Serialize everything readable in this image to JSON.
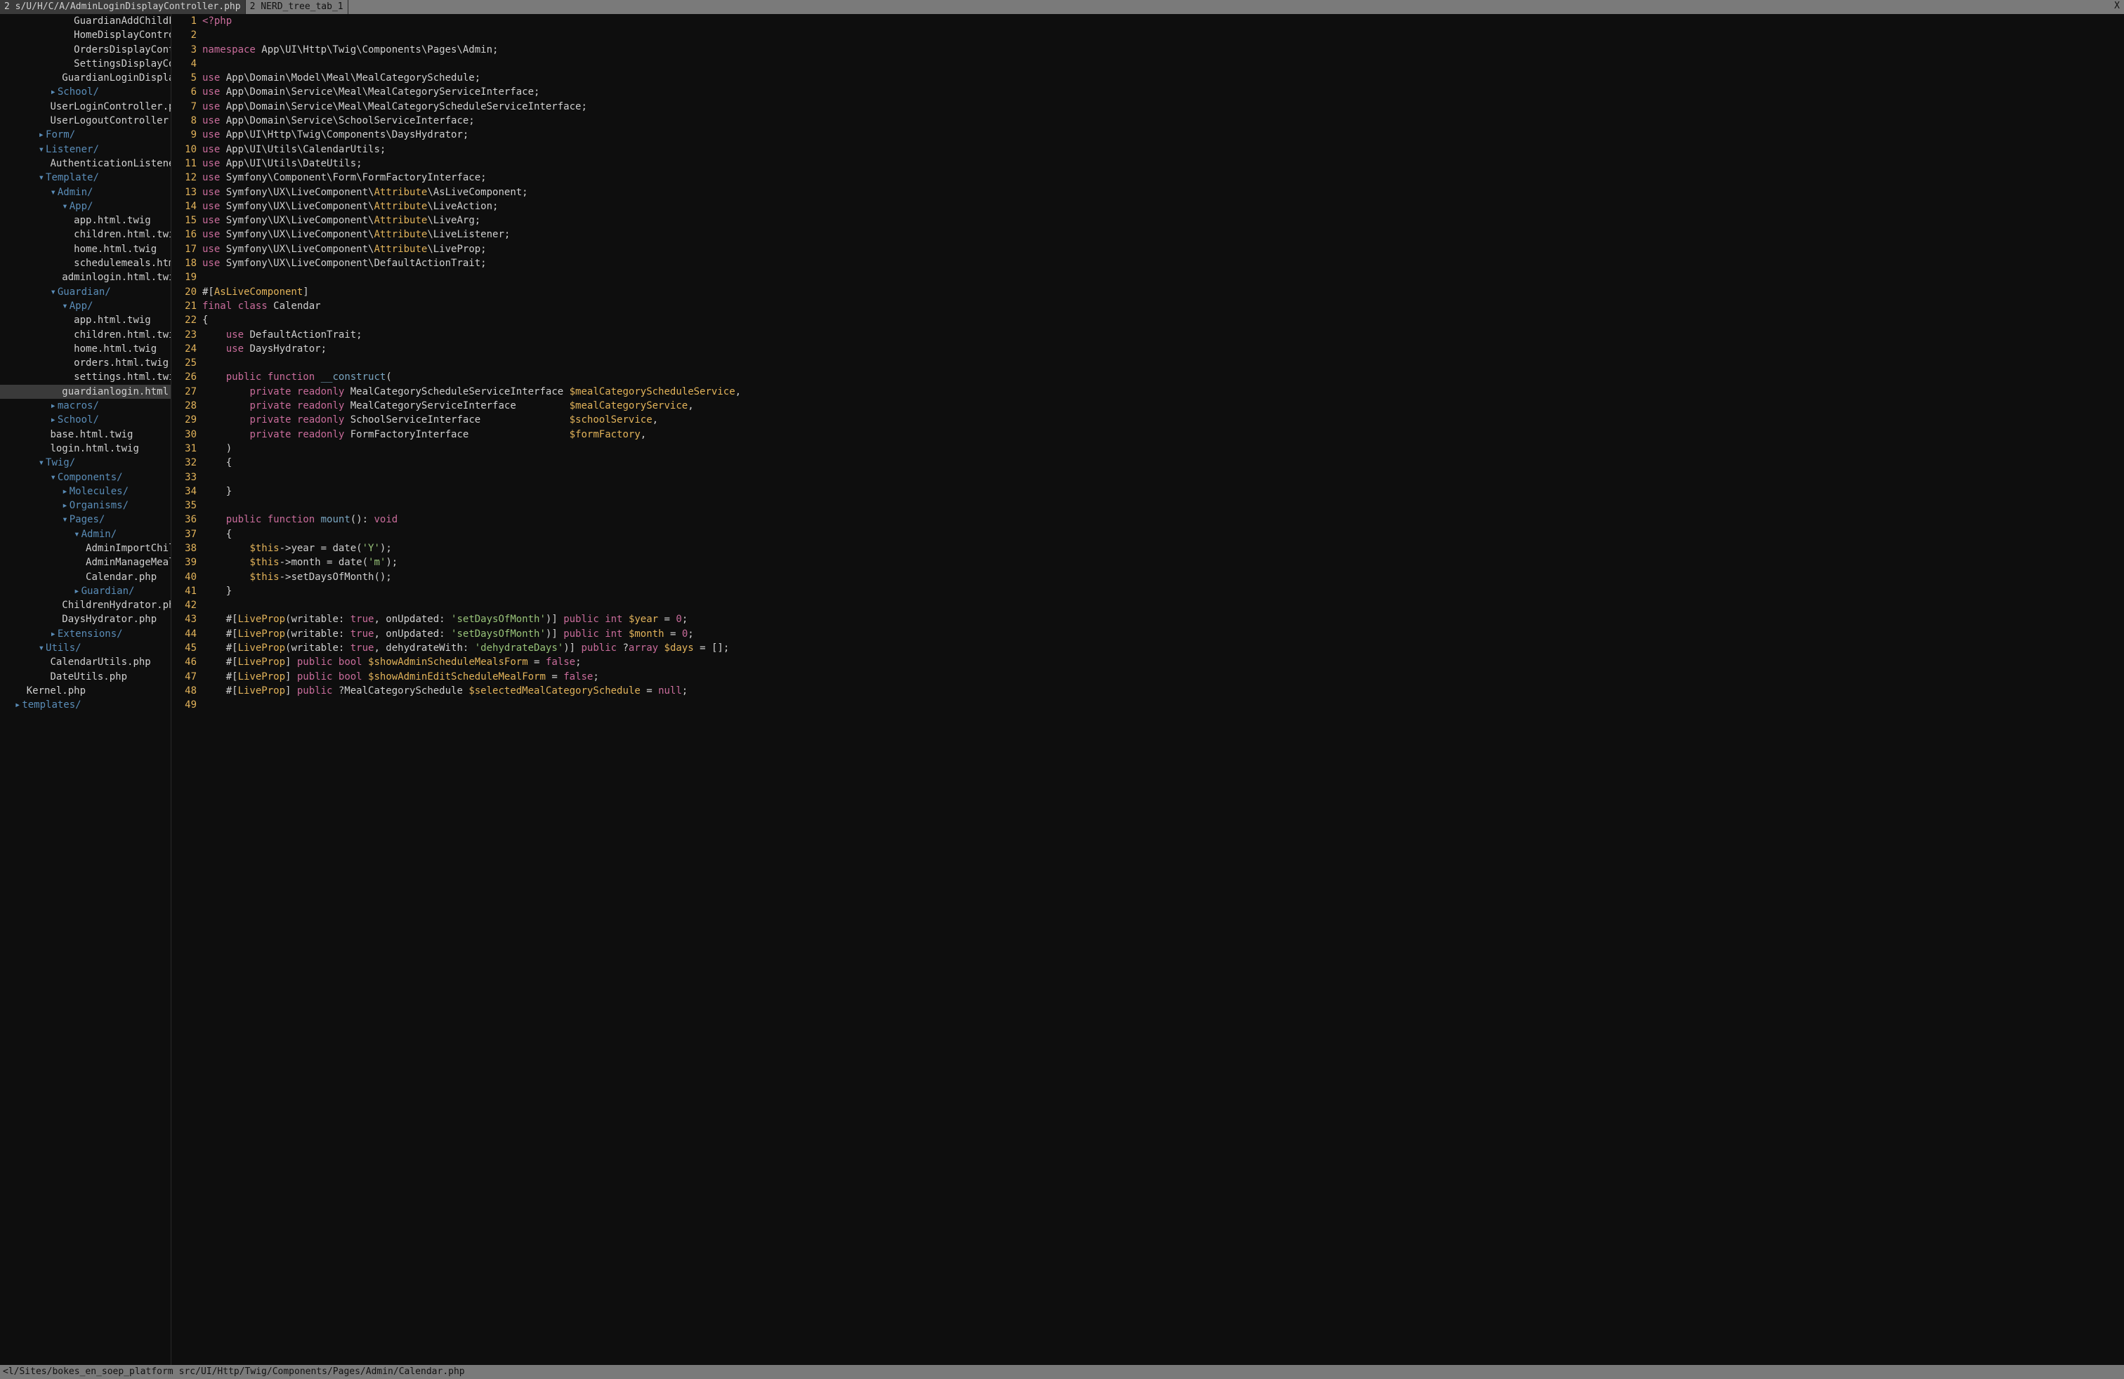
{
  "tabs": [
    {
      "num": "2",
      "label": "s/U/H/C/A/AdminLoginDisplayController.php"
    },
    {
      "num": "2",
      "label": "NERD_tree_tab_1"
    }
  ],
  "tab_close": "X",
  "status": {
    "left": "<l/Sites/bokes_en_soep_platform",
    "right": "src/UI/Http/Twig/Components/Pages/Admin/Calendar.php"
  },
  "tree": [
    {
      "indent": 6,
      "type": "file",
      "name": "GuardianAddChildF"
    },
    {
      "indent": 6,
      "type": "file",
      "name": "HomeDisplayContro"
    },
    {
      "indent": 6,
      "type": "file",
      "name": "OrdersDisplayCont"
    },
    {
      "indent": 6,
      "type": "file",
      "name": "SettingsDisplayCo"
    },
    {
      "indent": 5,
      "type": "file",
      "name": "GuardianLoginDispla"
    },
    {
      "indent": 4,
      "type": "dir-closed",
      "name": "School/"
    },
    {
      "indent": 4,
      "type": "file",
      "name": "UserLoginController.p"
    },
    {
      "indent": 4,
      "type": "file",
      "name": "UserLogoutController."
    },
    {
      "indent": 3,
      "type": "dir-closed",
      "name": "Form/"
    },
    {
      "indent": 3,
      "type": "dir-open",
      "name": "Listener/"
    },
    {
      "indent": 4,
      "type": "file",
      "name": "AuthenticationListene"
    },
    {
      "indent": 3,
      "type": "dir-open",
      "name": "Template/"
    },
    {
      "indent": 4,
      "type": "dir-open",
      "name": "Admin/"
    },
    {
      "indent": 5,
      "type": "dir-open",
      "name": "App/"
    },
    {
      "indent": 6,
      "type": "file",
      "name": "app.html.twig"
    },
    {
      "indent": 6,
      "type": "file",
      "name": "children.html.twi"
    },
    {
      "indent": 6,
      "type": "file",
      "name": "home.html.twig"
    },
    {
      "indent": 6,
      "type": "file",
      "name": "schedulemeals.htm"
    },
    {
      "indent": 5,
      "type": "file",
      "name": "adminlogin.html.twi"
    },
    {
      "indent": 4,
      "type": "dir-open",
      "name": "Guardian/"
    },
    {
      "indent": 5,
      "type": "dir-open",
      "name": "App/"
    },
    {
      "indent": 6,
      "type": "file",
      "name": "app.html.twig"
    },
    {
      "indent": 6,
      "type": "file",
      "name": "children.html.twi"
    },
    {
      "indent": 6,
      "type": "file",
      "name": "home.html.twig"
    },
    {
      "indent": 6,
      "type": "file",
      "name": "orders.html.twig"
    },
    {
      "indent": 6,
      "type": "file",
      "name": "settings.html.twi"
    },
    {
      "indent": 5,
      "type": "file",
      "name": "guardianlogin.html.",
      "selected": true
    },
    {
      "indent": 4,
      "type": "dir-closed",
      "name": "macros/"
    },
    {
      "indent": 4,
      "type": "dir-closed",
      "name": "School/"
    },
    {
      "indent": 4,
      "type": "file",
      "name": "base.html.twig"
    },
    {
      "indent": 4,
      "type": "file",
      "name": "login.html.twig"
    },
    {
      "indent": 3,
      "type": "dir-open",
      "name": "Twig/"
    },
    {
      "indent": 4,
      "type": "dir-open",
      "name": "Components/"
    },
    {
      "indent": 5,
      "type": "dir-closed",
      "name": "Molecules/"
    },
    {
      "indent": 5,
      "type": "dir-closed",
      "name": "Organisms/"
    },
    {
      "indent": 5,
      "type": "dir-open",
      "name": "Pages/"
    },
    {
      "indent": 6,
      "type": "dir-open",
      "name": "Admin/"
    },
    {
      "indent": 7,
      "type": "file",
      "name": "AdminImportChil"
    },
    {
      "indent": 7,
      "type": "file",
      "name": "AdminManageMeal"
    },
    {
      "indent": 7,
      "type": "file",
      "name": "Calendar.php"
    },
    {
      "indent": 6,
      "type": "dir-closed",
      "name": "Guardian/"
    },
    {
      "indent": 5,
      "type": "file",
      "name": "ChildrenHydrator.ph"
    },
    {
      "indent": 5,
      "type": "file",
      "name": "DaysHydrator.php"
    },
    {
      "indent": 4,
      "type": "dir-closed",
      "name": "Extensions/"
    },
    {
      "indent": 3,
      "type": "dir-open",
      "name": "Utils/"
    },
    {
      "indent": 4,
      "type": "file",
      "name": "CalendarUtils.php"
    },
    {
      "indent": 4,
      "type": "file",
      "name": "DateUtils.php"
    },
    {
      "indent": 2,
      "type": "file",
      "name": "Kernel.php"
    },
    {
      "indent": 1,
      "type": "dir-closed",
      "name": "templates/"
    }
  ],
  "code": {
    "start_line": 1,
    "lines": [
      [
        [
          "php",
          "<?php"
        ]
      ],
      [],
      [
        [
          "kw",
          "namespace"
        ],
        [
          "punct",
          " App\\UI\\Http\\Twig\\Components\\Pages\\Admin;"
        ]
      ],
      [],
      [
        [
          "kw",
          "use"
        ],
        [
          "punct",
          " App\\Domain\\Model\\Meal\\MealCategorySchedule;"
        ]
      ],
      [
        [
          "kw",
          "use"
        ],
        [
          "punct",
          " App\\Domain\\Service\\Meal\\MealCategoryServiceInterface;"
        ]
      ],
      [
        [
          "kw",
          "use"
        ],
        [
          "punct",
          " App\\Domain\\Service\\Meal\\MealCategoryScheduleServiceInterface;"
        ]
      ],
      [
        [
          "kw",
          "use"
        ],
        [
          "punct",
          " App\\Domain\\Service\\SchoolServiceInterface;"
        ]
      ],
      [
        [
          "kw",
          "use"
        ],
        [
          "punct",
          " App\\UI\\Http\\Twig\\Components\\DaysHydrator;"
        ]
      ],
      [
        [
          "kw",
          "use"
        ],
        [
          "punct",
          " App\\UI\\Utils\\CalendarUtils;"
        ]
      ],
      [
        [
          "kw",
          "use"
        ],
        [
          "punct",
          " App\\UI\\Utils\\DateUtils;"
        ]
      ],
      [
        [
          "kw",
          "use"
        ],
        [
          "punct",
          " Symfony\\Component\\Form\\FormFactoryInterface;"
        ]
      ],
      [
        [
          "kw",
          "use"
        ],
        [
          "punct",
          " Symfony\\UX\\LiveComponent\\"
        ],
        [
          "attr",
          "Attribute"
        ],
        [
          "punct",
          "\\AsLiveComponent;"
        ]
      ],
      [
        [
          "kw",
          "use"
        ],
        [
          "punct",
          " Symfony\\UX\\LiveComponent\\"
        ],
        [
          "attr",
          "Attribute"
        ],
        [
          "punct",
          "\\LiveAction;"
        ]
      ],
      [
        [
          "kw",
          "use"
        ],
        [
          "punct",
          " Symfony\\UX\\LiveComponent\\"
        ],
        [
          "attr",
          "Attribute"
        ],
        [
          "punct",
          "\\LiveArg;"
        ]
      ],
      [
        [
          "kw",
          "use"
        ],
        [
          "punct",
          " Symfony\\UX\\LiveComponent\\"
        ],
        [
          "attr",
          "Attribute"
        ],
        [
          "punct",
          "\\LiveListener;"
        ]
      ],
      [
        [
          "kw",
          "use"
        ],
        [
          "punct",
          " Symfony\\UX\\LiveComponent\\"
        ],
        [
          "attr",
          "Attribute"
        ],
        [
          "punct",
          "\\LiveProp;"
        ]
      ],
      [
        [
          "kw",
          "use"
        ],
        [
          "punct",
          " Symfony\\UX\\LiveComponent\\DefaultActionTrait;"
        ]
      ],
      [],
      [
        [
          "punct",
          "#["
        ],
        [
          "attr",
          "AsLiveComponent"
        ],
        [
          "punct",
          "]"
        ]
      ],
      [
        [
          "kw",
          "final class"
        ],
        [
          "punct",
          " Calendar"
        ]
      ],
      [
        [
          "punct",
          "{"
        ]
      ],
      [
        [
          "punct",
          "    "
        ],
        [
          "kw",
          "use"
        ],
        [
          "punct",
          " DefaultActionTrait;"
        ]
      ],
      [
        [
          "punct",
          "    "
        ],
        [
          "kw",
          "use"
        ],
        [
          "punct",
          " DaysHydrator;"
        ]
      ],
      [],
      [
        [
          "punct",
          "    "
        ],
        [
          "kw",
          "public"
        ],
        [
          "punct",
          " "
        ],
        [
          "kw",
          "function"
        ],
        [
          "punct",
          " "
        ],
        [
          "fn",
          "__construct"
        ],
        [
          "punct",
          "("
        ]
      ],
      [
        [
          "punct",
          "        "
        ],
        [
          "kw",
          "private"
        ],
        [
          "punct",
          " "
        ],
        [
          "kw",
          "readonly"
        ],
        [
          "punct",
          " MealCategoryScheduleServiceInterface "
        ],
        [
          "var",
          "$mealCategoryScheduleService"
        ],
        [
          "punct",
          ","
        ]
      ],
      [
        [
          "punct",
          "        "
        ],
        [
          "kw",
          "private"
        ],
        [
          "punct",
          " "
        ],
        [
          "kw",
          "readonly"
        ],
        [
          "punct",
          " MealCategoryServiceInterface         "
        ],
        [
          "var",
          "$mealCategoryService"
        ],
        [
          "punct",
          ","
        ]
      ],
      [
        [
          "punct",
          "        "
        ],
        [
          "kw",
          "private"
        ],
        [
          "punct",
          " "
        ],
        [
          "kw",
          "readonly"
        ],
        [
          "punct",
          " SchoolServiceInterface               "
        ],
        [
          "var",
          "$schoolService"
        ],
        [
          "punct",
          ","
        ]
      ],
      [
        [
          "punct",
          "        "
        ],
        [
          "kw",
          "private"
        ],
        [
          "punct",
          " "
        ],
        [
          "kw",
          "readonly"
        ],
        [
          "punct",
          " FormFactoryInterface                 "
        ],
        [
          "var",
          "$formFactory"
        ],
        [
          "punct",
          ","
        ]
      ],
      [
        [
          "punct",
          "    )"
        ]
      ],
      [
        [
          "punct",
          "    {"
        ]
      ],
      [],
      [
        [
          "punct",
          "    }"
        ]
      ],
      [],
      [
        [
          "punct",
          "    "
        ],
        [
          "kw",
          "public"
        ],
        [
          "punct",
          " "
        ],
        [
          "kw",
          "function"
        ],
        [
          "punct",
          " "
        ],
        [
          "fn",
          "mount"
        ],
        [
          "punct",
          "(): "
        ],
        [
          "kw",
          "void"
        ]
      ],
      [
        [
          "punct",
          "    {"
        ]
      ],
      [
        [
          "punct",
          "        "
        ],
        [
          "var",
          "$this"
        ],
        [
          "punct",
          "->year = date("
        ],
        [
          "str",
          "'Y'"
        ],
        [
          "punct",
          ");"
        ]
      ],
      [
        [
          "punct",
          "        "
        ],
        [
          "var",
          "$this"
        ],
        [
          "punct",
          "->month = date("
        ],
        [
          "str",
          "'m'"
        ],
        [
          "punct",
          ");"
        ]
      ],
      [
        [
          "punct",
          "        "
        ],
        [
          "var",
          "$this"
        ],
        [
          "punct",
          "->setDaysOfMonth();"
        ]
      ],
      [
        [
          "punct",
          "    }"
        ]
      ],
      [],
      [
        [
          "punct",
          "    #["
        ],
        [
          "attr",
          "LiveProp"
        ],
        [
          "punct",
          "(writable: "
        ],
        [
          "kw",
          "true"
        ],
        [
          "punct",
          ", onUpdated: "
        ],
        [
          "str",
          "'setDaysOfMonth'"
        ],
        [
          "punct",
          ")] "
        ],
        [
          "kw",
          "public"
        ],
        [
          "punct",
          " "
        ],
        [
          "kw",
          "int"
        ],
        [
          "punct",
          " "
        ],
        [
          "var",
          "$year"
        ],
        [
          "punct",
          " = "
        ],
        [
          "num",
          "0"
        ],
        [
          "punct",
          ";"
        ]
      ],
      [
        [
          "punct",
          "    #["
        ],
        [
          "attr",
          "LiveProp"
        ],
        [
          "punct",
          "(writable: "
        ],
        [
          "kw",
          "true"
        ],
        [
          "punct",
          ", onUpdated: "
        ],
        [
          "str",
          "'setDaysOfMonth'"
        ],
        [
          "punct",
          ")] "
        ],
        [
          "kw",
          "public"
        ],
        [
          "punct",
          " "
        ],
        [
          "kw",
          "int"
        ],
        [
          "punct",
          " "
        ],
        [
          "var",
          "$month"
        ],
        [
          "punct",
          " = "
        ],
        [
          "num",
          "0"
        ],
        [
          "punct",
          ";"
        ]
      ],
      [
        [
          "punct",
          "    #["
        ],
        [
          "attr",
          "LiveProp"
        ],
        [
          "punct",
          "(writable: "
        ],
        [
          "kw",
          "true"
        ],
        [
          "punct",
          ", dehydrateWith: "
        ],
        [
          "str",
          "'dehydrateDays'"
        ],
        [
          "punct",
          ")] "
        ],
        [
          "kw",
          "public"
        ],
        [
          "punct",
          " ?"
        ],
        [
          "kw",
          "array"
        ],
        [
          "punct",
          " "
        ],
        [
          "var",
          "$days"
        ],
        [
          "punct",
          " = [];"
        ]
      ],
      [
        [
          "punct",
          "    #["
        ],
        [
          "attr",
          "LiveProp"
        ],
        [
          "punct",
          "] "
        ],
        [
          "kw",
          "public"
        ],
        [
          "punct",
          " "
        ],
        [
          "kw",
          "bool"
        ],
        [
          "punct",
          " "
        ],
        [
          "var",
          "$showAdminScheduleMealsForm"
        ],
        [
          "punct",
          " = "
        ],
        [
          "kw",
          "false"
        ],
        [
          "punct",
          ";"
        ]
      ],
      [
        [
          "punct",
          "    #["
        ],
        [
          "attr",
          "LiveProp"
        ],
        [
          "punct",
          "] "
        ],
        [
          "kw",
          "public"
        ],
        [
          "punct",
          " "
        ],
        [
          "kw",
          "bool"
        ],
        [
          "punct",
          " "
        ],
        [
          "var",
          "$showAdminEditScheduleMealForm"
        ],
        [
          "punct",
          " = "
        ],
        [
          "kw",
          "false"
        ],
        [
          "punct",
          ";"
        ]
      ],
      [
        [
          "punct",
          "    #["
        ],
        [
          "attr",
          "LiveProp"
        ],
        [
          "punct",
          "] "
        ],
        [
          "kw",
          "public"
        ],
        [
          "punct",
          " ?MealCategorySchedule "
        ],
        [
          "var",
          "$selectedMealCategorySchedule"
        ],
        [
          "punct",
          " = "
        ],
        [
          "kw",
          "null"
        ],
        [
          "punct",
          ";"
        ]
      ],
      []
    ]
  }
}
